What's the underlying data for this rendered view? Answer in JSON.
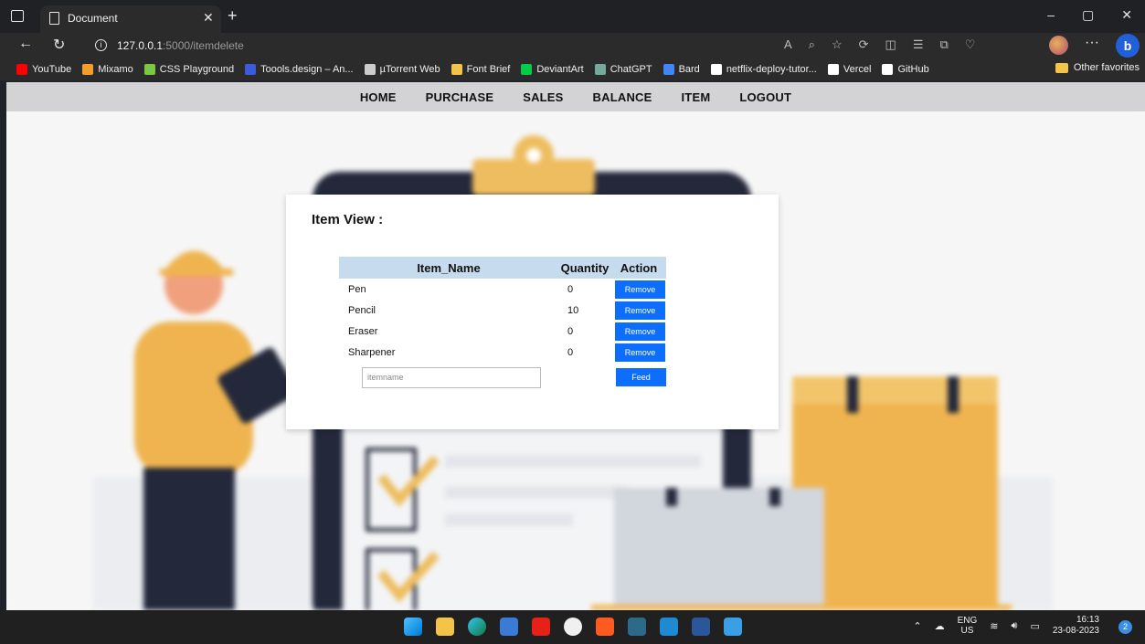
{
  "browser": {
    "tab_title": "Document",
    "url_host": "127.0.0.1",
    "url_path": ":5000/itemdelete",
    "bookmarks": [
      {
        "label": "YouTube",
        "color": "#ff0000"
      },
      {
        "label": "Mixamo",
        "color": "#f29e2b"
      },
      {
        "label": "CSS Playground",
        "color": "#7ac943"
      },
      {
        "label": "Toools.design – An...",
        "color": "#3b5bdb"
      },
      {
        "label": "µTorrent Web",
        "color": "#cccccc"
      },
      {
        "label": "Font Brief",
        "color": "#f3c34a"
      },
      {
        "label": "DeviantArt",
        "color": "#05cc47"
      },
      {
        "label": "ChatGPT",
        "color": "#74aa9c"
      },
      {
        "label": "Bard",
        "color": "#4285f4"
      },
      {
        "label": "netflix-deploy-tutor...",
        "color": "#ffffff"
      },
      {
        "label": "Vercel",
        "color": "#ffffff"
      },
      {
        "label": "GitHub",
        "color": "#ffffff"
      }
    ],
    "other_favorites": "Other favorites"
  },
  "nav": {
    "home": "HOME",
    "purchase": "PURCHASE",
    "sales": "SALES",
    "balance": "BALANCE",
    "item": "ITEM",
    "logout": "LOGOUT"
  },
  "card": {
    "title": "Item View :",
    "headers": {
      "name": "Item_Name",
      "quantity": "Quantity",
      "action": "Action"
    },
    "rows": [
      {
        "name": "Pen",
        "quantity": "0",
        "action": "Remove"
      },
      {
        "name": "Pencil",
        "quantity": "10",
        "action": "Remove"
      },
      {
        "name": "Eraser",
        "quantity": "0",
        "action": "Remove"
      },
      {
        "name": "Sharpener",
        "quantity": "0",
        "action": "Remove"
      }
    ],
    "input_placeholder": "itemname",
    "feed_label": "Feed",
    "accent": "#0d6efd"
  },
  "taskbar": {
    "lang_top": "ENG",
    "lang_bottom": "US",
    "time": "16:13",
    "date": "23-08-2023",
    "notifications": "2"
  }
}
